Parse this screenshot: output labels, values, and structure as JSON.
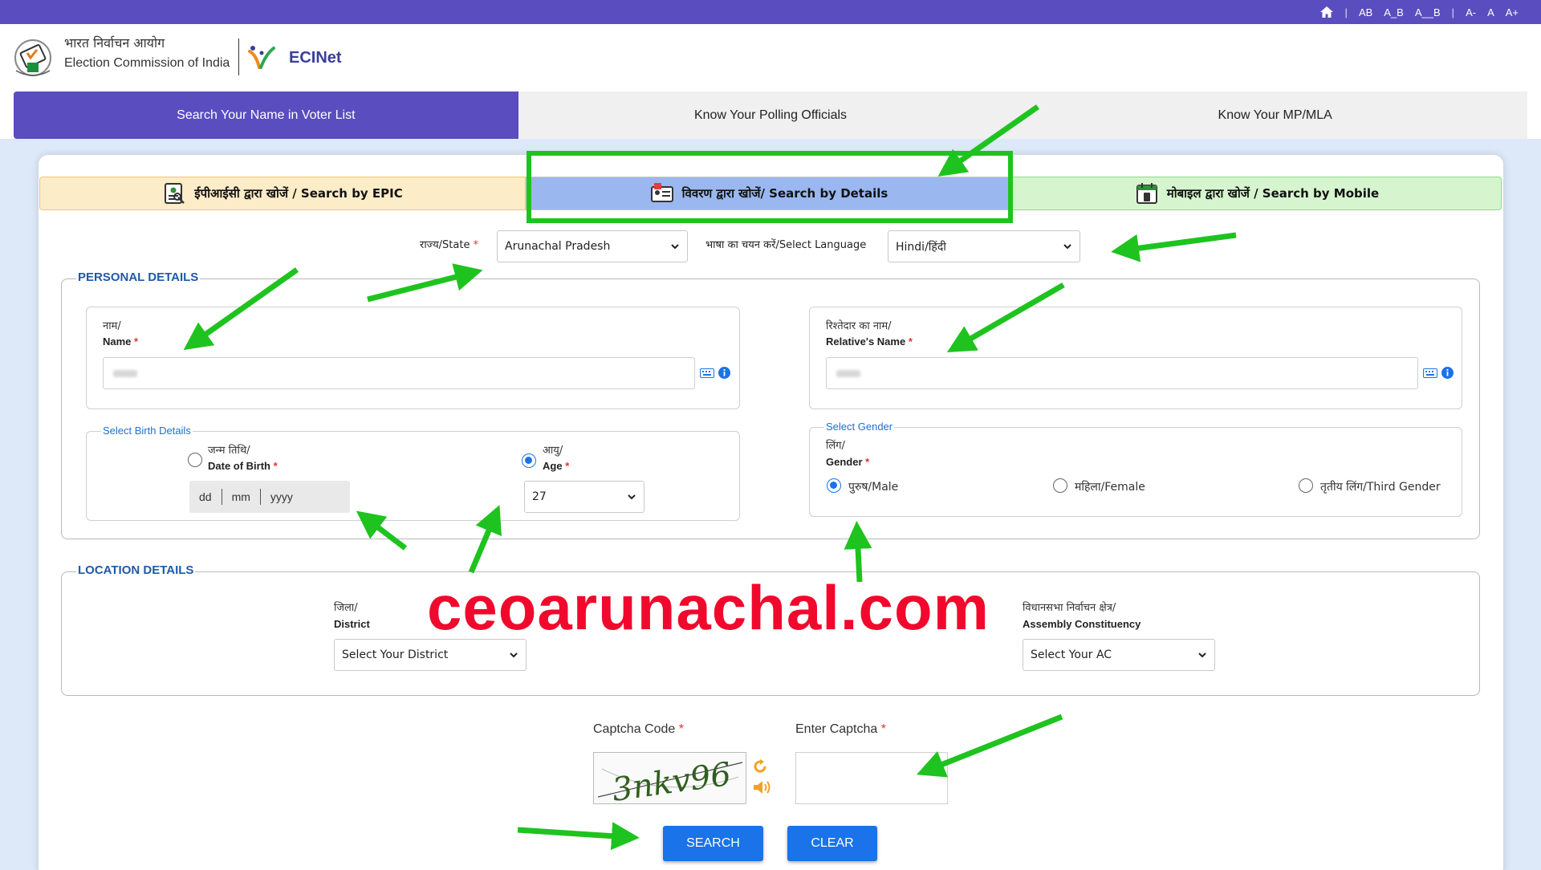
{
  "topbar": {
    "font_tools": [
      "AB",
      "A_B",
      "A__B"
    ],
    "size_tools": [
      "A-",
      "A",
      "A+"
    ],
    "separator": "|"
  },
  "header": {
    "org_hindi": "भारत निर्वाचन आयोग",
    "org_english": "Election Commission of India",
    "app_name": "ECINet"
  },
  "main_tabs": [
    {
      "label": "Search Your Name in Voter List",
      "active": true
    },
    {
      "label": "Know Your Polling Officials",
      "active": false
    },
    {
      "label": "Know Your MP/MLA",
      "active": false
    }
  ],
  "mode_tabs": {
    "epic": "ईपीआईसी द्वारा खोजें / Search by EPIC",
    "details": "विवरण द्वारा खोजें/ Search by Details",
    "mobile": "मोबाइल द्वारा खोजें / Search by Mobile"
  },
  "state": {
    "label": "राज्य/State",
    "value": "Arunachal Pradesh"
  },
  "language": {
    "label": "भाषा का चयन करें/Select Language",
    "value": "Hindi/हिंदी"
  },
  "personal": {
    "legend": "PERSONAL DETAILS",
    "name_hi": "नाम/",
    "name_en": "Name",
    "relative_hi": "रिश्तेदार का नाम/",
    "relative_en": "Relative's Name",
    "birth_legend": "Select Birth Details",
    "dob_hi": "जन्म तिथि/",
    "dob_en": "Date of Birth",
    "dob_dd": "dd",
    "dob_mm": "mm",
    "dob_yyyy": "yyyy",
    "age_hi": "आयु/",
    "age_en": "Age",
    "age_value": "27",
    "gender_legend": "Select Gender",
    "gender_hi": "लिंग/",
    "gender_en": "Gender",
    "gender_options": [
      "पुरुष/Male",
      "महिला/Female",
      "तृतीय लिंग/Third Gender"
    ],
    "required_mark": "*"
  },
  "location": {
    "legend": "LOCATION DETAILS",
    "district_hi": "जिला/",
    "district_en": "District",
    "district_value": "Select Your District",
    "ac_hi": "विधानसभा निर्वाचन क्षेत्र/",
    "ac_en": "Assembly Constituency",
    "ac_value": "Select Your AC"
  },
  "captcha": {
    "code_label": "Captcha Code",
    "enter_label": "Enter Captcha",
    "code_text": "3nkv96"
  },
  "buttons": {
    "search": "SEARCH",
    "clear": "CLEAR"
  },
  "watermark": "ceoarunachal.com",
  "colors": {
    "primary": "#5a4dbf",
    "highlight": "#1fc31f",
    "watermark": "#f1092d",
    "button": "#1a73e8"
  }
}
